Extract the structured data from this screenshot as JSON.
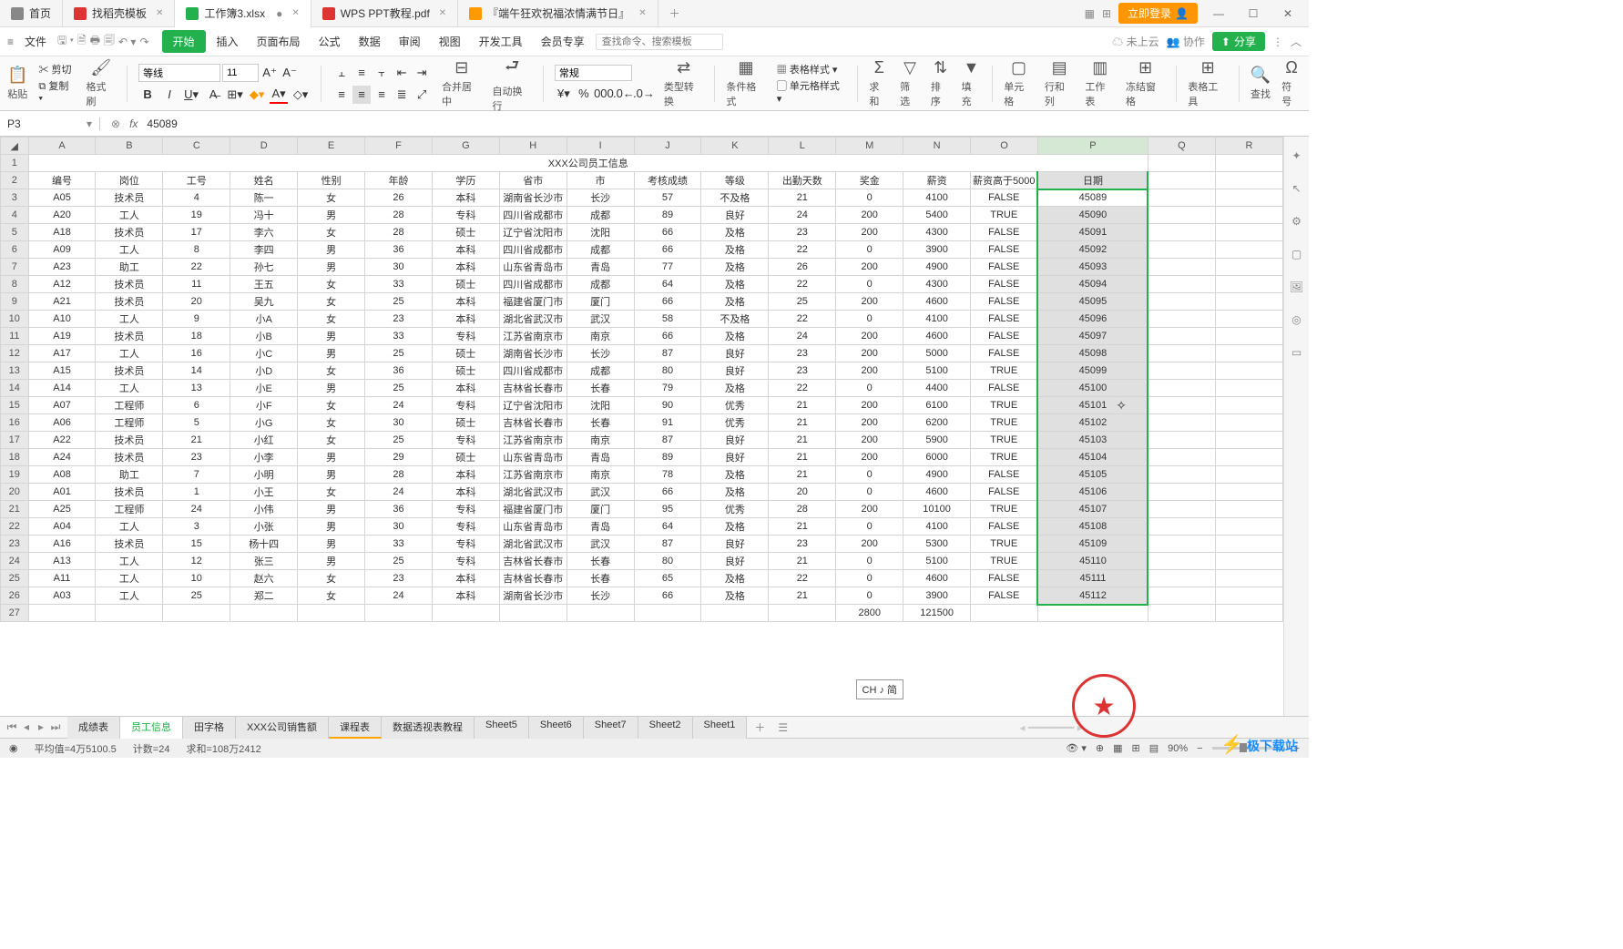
{
  "titlebar": {
    "tabs": [
      {
        "label": "首页",
        "icon": "home"
      },
      {
        "label": "找稻壳模板",
        "icon": "doc-red"
      },
      {
        "label": "工作簿3.xlsx",
        "icon": "xls",
        "active": true,
        "modified": true
      },
      {
        "label": "WPS PPT教程.pdf",
        "icon": "pdf"
      },
      {
        "label": "『端午狂欢祝福浓情满节日』",
        "icon": "ppt"
      }
    ],
    "login": "立即登录"
  },
  "menubar": {
    "file": "文件",
    "items": [
      "开始",
      "插入",
      "页面布局",
      "公式",
      "数据",
      "审阅",
      "视图",
      "开发工具",
      "会员专享"
    ],
    "search_placeholder": "查找命令、搜索模板",
    "cloud": "未上云",
    "collab": "协作",
    "share": "分享"
  },
  "ribbon": {
    "paste": "粘贴",
    "cut": "剪切",
    "copy": "复制",
    "format_painter": "格式刷",
    "font_name": "等线",
    "font_size": "11",
    "merge": "合并居中",
    "wrap": "自动换行",
    "number_format": "常规",
    "type_convert": "类型转换",
    "cond_fmt": "条件格式",
    "table_style": "表格样式",
    "cell_style": "单元格样式",
    "sum": "求和",
    "filter": "筛选",
    "sort": "排序",
    "fill": "填充",
    "cells": "单元格",
    "rows_cols": "行和列",
    "worksheet": "工作表",
    "freeze": "冻结窗格",
    "table_tools": "表格工具",
    "find": "查找",
    "symbol": "符号"
  },
  "formula_bar": {
    "name_box": "P3",
    "formula": "45089"
  },
  "sheet": {
    "columns": [
      "A",
      "B",
      "C",
      "D",
      "E",
      "F",
      "G",
      "H",
      "I",
      "J",
      "K",
      "L",
      "M",
      "N",
      "O",
      "P",
      "Q",
      "R"
    ],
    "title": "XXX公司员工信息",
    "headers": [
      "编号",
      "岗位",
      "工号",
      "姓名",
      "性别",
      "年龄",
      "学历",
      "省市",
      "市",
      "考核成绩",
      "等级",
      "出勤天数",
      "奖金",
      "薪资",
      "薪资高于5000",
      "日期"
    ],
    "rows": [
      [
        "A05",
        "技术员",
        "4",
        "陈一",
        "女",
        "26",
        "本科",
        "湖南省长沙市",
        "长沙",
        "57",
        "不及格",
        "21",
        "0",
        "4100",
        "FALSE",
        "45089"
      ],
      [
        "A20",
        "工人",
        "19",
        "冯十",
        "男",
        "28",
        "专科",
        "四川省成都市",
        "成都",
        "89",
        "良好",
        "24",
        "200",
        "5400",
        "TRUE",
        "45090"
      ],
      [
        "A18",
        "技术员",
        "17",
        "李六",
        "女",
        "28",
        "硕士",
        "辽宁省沈阳市",
        "沈阳",
        "66",
        "及格",
        "23",
        "200",
        "4300",
        "FALSE",
        "45091"
      ],
      [
        "A09",
        "工人",
        "8",
        "李四",
        "男",
        "36",
        "本科",
        "四川省成都市",
        "成都",
        "66",
        "及格",
        "22",
        "0",
        "3900",
        "FALSE",
        "45092"
      ],
      [
        "A23",
        "助工",
        "22",
        "孙七",
        "男",
        "30",
        "本科",
        "山东省青岛市",
        "青岛",
        "77",
        "及格",
        "26",
        "200",
        "4900",
        "FALSE",
        "45093"
      ],
      [
        "A12",
        "技术员",
        "11",
        "王五",
        "女",
        "33",
        "硕士",
        "四川省成都市",
        "成都",
        "64",
        "及格",
        "22",
        "0",
        "4300",
        "FALSE",
        "45094"
      ],
      [
        "A21",
        "技术员",
        "20",
        "吴九",
        "女",
        "25",
        "本科",
        "福建省厦门市",
        "厦门",
        "66",
        "及格",
        "25",
        "200",
        "4600",
        "FALSE",
        "45095"
      ],
      [
        "A10",
        "工人",
        "9",
        "小A",
        "女",
        "23",
        "本科",
        "湖北省武汉市",
        "武汉",
        "58",
        "不及格",
        "22",
        "0",
        "4100",
        "FALSE",
        "45096"
      ],
      [
        "A19",
        "技术员",
        "18",
        "小B",
        "男",
        "33",
        "专科",
        "江苏省南京市",
        "南京",
        "66",
        "及格",
        "24",
        "200",
        "4600",
        "FALSE",
        "45097"
      ],
      [
        "A17",
        "工人",
        "16",
        "小C",
        "男",
        "25",
        "硕士",
        "湖南省长沙市",
        "长沙",
        "87",
        "良好",
        "23",
        "200",
        "5000",
        "FALSE",
        "45098"
      ],
      [
        "A15",
        "技术员",
        "14",
        "小D",
        "女",
        "36",
        "硕士",
        "四川省成都市",
        "成都",
        "80",
        "良好",
        "23",
        "200",
        "5100",
        "TRUE",
        "45099"
      ],
      [
        "A14",
        "工人",
        "13",
        "小E",
        "男",
        "25",
        "本科",
        "吉林省长春市",
        "长春",
        "79",
        "及格",
        "22",
        "0",
        "4400",
        "FALSE",
        "45100"
      ],
      [
        "A07",
        "工程师",
        "6",
        "小F",
        "女",
        "24",
        "专科",
        "辽宁省沈阳市",
        "沈阳",
        "90",
        "优秀",
        "21",
        "200",
        "6100",
        "TRUE",
        "45101"
      ],
      [
        "A06",
        "工程师",
        "5",
        "小G",
        "女",
        "30",
        "硕士",
        "吉林省长春市",
        "长春",
        "91",
        "优秀",
        "21",
        "200",
        "6200",
        "TRUE",
        "45102"
      ],
      [
        "A22",
        "技术员",
        "21",
        "小红",
        "女",
        "25",
        "专科",
        "江苏省南京市",
        "南京",
        "87",
        "良好",
        "21",
        "200",
        "5900",
        "TRUE",
        "45103"
      ],
      [
        "A24",
        "技术员",
        "23",
        "小李",
        "男",
        "29",
        "硕士",
        "山东省青岛市",
        "青岛",
        "89",
        "良好",
        "21",
        "200",
        "6000",
        "TRUE",
        "45104"
      ],
      [
        "A08",
        "助工",
        "7",
        "小明",
        "男",
        "28",
        "本科",
        "江苏省南京市",
        "南京",
        "78",
        "及格",
        "21",
        "0",
        "4900",
        "FALSE",
        "45105"
      ],
      [
        "A01",
        "技术员",
        "1",
        "小王",
        "女",
        "24",
        "本科",
        "湖北省武汉市",
        "武汉",
        "66",
        "及格",
        "20",
        "0",
        "4600",
        "FALSE",
        "45106"
      ],
      [
        "A25",
        "工程师",
        "24",
        "小伟",
        "男",
        "36",
        "专科",
        "福建省厦门市",
        "厦门",
        "95",
        "优秀",
        "28",
        "200",
        "10100",
        "TRUE",
        "45107"
      ],
      [
        "A04",
        "工人",
        "3",
        "小张",
        "男",
        "30",
        "专科",
        "山东省青岛市",
        "青岛",
        "64",
        "及格",
        "21",
        "0",
        "4100",
        "FALSE",
        "45108"
      ],
      [
        "A16",
        "技术员",
        "15",
        "杨十四",
        "男",
        "33",
        "专科",
        "湖北省武汉市",
        "武汉",
        "87",
        "良好",
        "23",
        "200",
        "5300",
        "TRUE",
        "45109"
      ],
      [
        "A13",
        "工人",
        "12",
        "张三",
        "男",
        "25",
        "专科",
        "吉林省长春市",
        "长春",
        "80",
        "良好",
        "21",
        "0",
        "5100",
        "TRUE",
        "45110"
      ],
      [
        "A11",
        "工人",
        "10",
        "赵六",
        "女",
        "23",
        "本科",
        "吉林省长春市",
        "长春",
        "65",
        "及格",
        "22",
        "0",
        "4600",
        "FALSE",
        "45111"
      ],
      [
        "A03",
        "工人",
        "25",
        "郑二",
        "女",
        "24",
        "本科",
        "湖南省长沙市",
        "长沙",
        "66",
        "及格",
        "21",
        "0",
        "3900",
        "FALSE",
        "45112"
      ]
    ],
    "totals_row": {
      "M": "2800",
      "N": "121500"
    }
  },
  "sheet_tabs": [
    "成绩表",
    "员工信息",
    "田字格",
    "XXX公司销售额",
    "课程表",
    "数据透视表教程",
    "Sheet5",
    "Sheet6",
    "Sheet7",
    "Sheet2",
    "Sheet1"
  ],
  "active_sheet": "员工信息",
  "colored_sheet": "课程表",
  "status": {
    "avg": "平均值=4万5100.5",
    "count": "计数=24",
    "sum": "求和=108万2412",
    "zoom": "90%"
  },
  "ime": "CH ♪ 简",
  "watermark": "极下载站"
}
